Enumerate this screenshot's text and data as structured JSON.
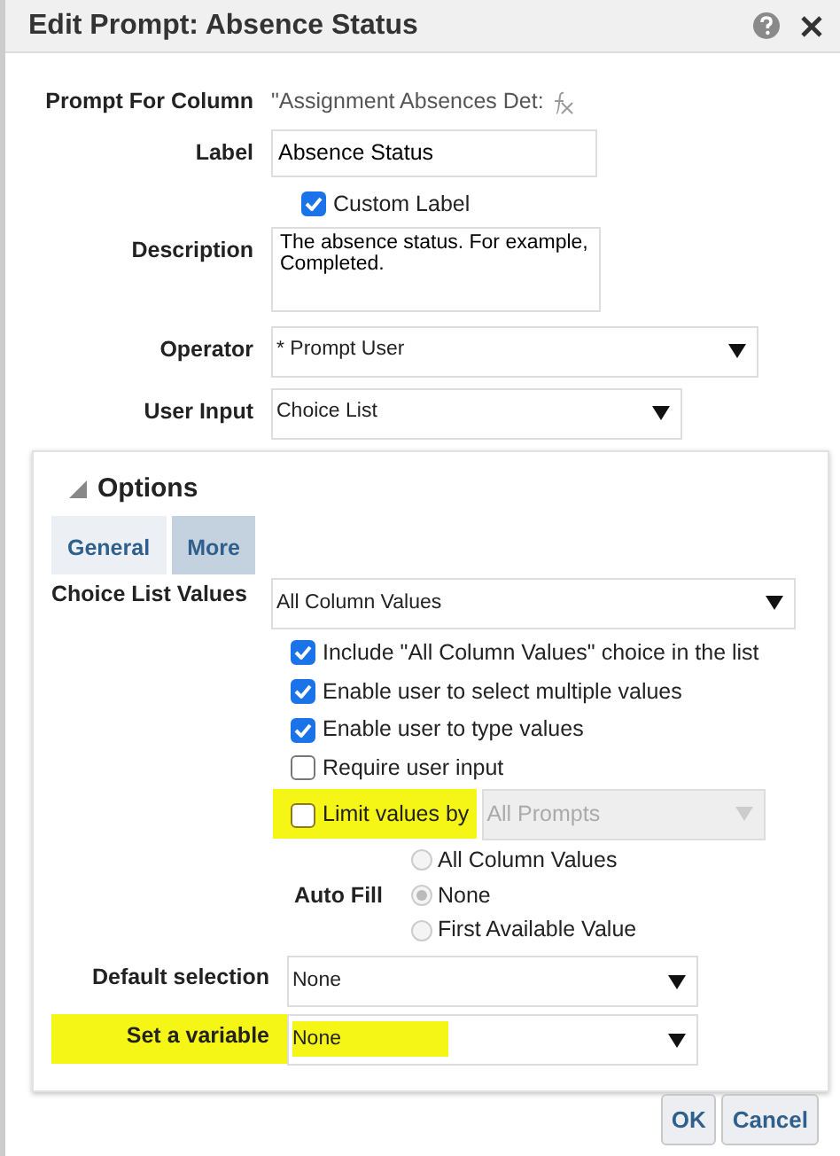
{
  "dialog": {
    "title": "Edit Prompt: Absence Status"
  },
  "fields": {
    "prompt_for_column": {
      "label": "Prompt For Column",
      "value": "\"Assignment Absences Det:"
    },
    "label": {
      "label": "Label",
      "value": "Absence Status"
    },
    "custom_label": {
      "label": "Custom Label",
      "checked": true
    },
    "description": {
      "label": "Description",
      "value": "The absence status. For example, Completed."
    },
    "operator": {
      "label": "Operator",
      "value": "* Prompt User"
    },
    "user_input": {
      "label": "User Input",
      "value": "Choice List"
    }
  },
  "options": {
    "title": "Options",
    "expanded": true,
    "tabs": [
      {
        "label": "General",
        "selected": false
      },
      {
        "label": "More",
        "selected": true
      }
    ],
    "choice_list_values": {
      "label": "Choice List Values",
      "value": "All Column Values"
    },
    "checkboxes": [
      {
        "label": "Include \"All Column Values\" choice in the list",
        "checked": true
      },
      {
        "label": "Enable user to select multiple values",
        "checked": true
      },
      {
        "label": "Enable user to type values",
        "checked": true
      },
      {
        "label": "Require user input",
        "checked": false
      }
    ],
    "limit_values": {
      "label": "Limit values by",
      "checked": false,
      "value": "All Prompts",
      "disabled": true,
      "highlighted": true
    },
    "auto_fill": {
      "label": "Auto Fill",
      "disabled": true,
      "options": [
        {
          "label": "All Column Values",
          "selected": false
        },
        {
          "label": "None",
          "selected": true
        },
        {
          "label": "First Available Value",
          "selected": false
        }
      ]
    },
    "default_selection": {
      "label": "Default selection",
      "value": "None"
    },
    "set_variable": {
      "label": "Set a variable",
      "value": "None",
      "highlighted": true
    }
  },
  "buttons": [
    {
      "label": "OK"
    },
    {
      "label": "Cancel"
    }
  ]
}
